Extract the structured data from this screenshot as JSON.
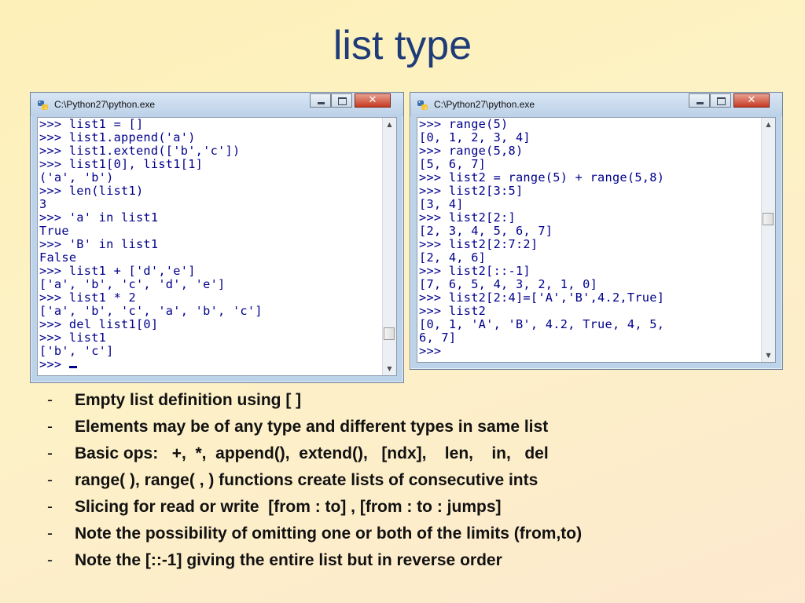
{
  "slide": {
    "title": "list type"
  },
  "windows": [
    {
      "title": "C:\\Python27\\python.exe",
      "icon": "python-icon",
      "controls": {
        "minimize": "minimize-icon",
        "maximize": "maximize-icon",
        "close": "close-icon"
      },
      "lines": [
        ">>> list1 = []",
        ">>> list1.append('a')",
        ">>> list1.extend(['b','c'])",
        ">>> list1[0], list1[1]",
        "('a', 'b')",
        ">>> len(list1)",
        "3",
        ">>> 'a' in list1",
        "True",
        ">>> 'B' in list1",
        "False",
        ">>> list1 + ['d','e']",
        "['a', 'b', 'c', 'd', 'e']",
        ">>> list1 * 2",
        "['a', 'b', 'c', 'a', 'b', 'c']",
        ">>> del list1[0]",
        ">>> list1",
        "['b', 'c']",
        ">>> "
      ],
      "scroll_position": 0.9
    },
    {
      "title": "C:\\Python27\\python.exe",
      "icon": "python-icon",
      "controls": {
        "minimize": "minimize-icon",
        "maximize": "maximize-icon",
        "close": "close-icon"
      },
      "lines": [
        ">>> range(5)",
        "[0, 1, 2, 3, 4]",
        ">>> range(5,8)",
        "[5, 6, 7]",
        ">>> list2 = range(5) + range(5,8)",
        ">>> list2[3:5]",
        "[3, 4]",
        ">>> list2[2:]",
        "[2, 3, 4, 5, 6, 7]",
        ">>> list2[2:7:2]",
        "[2, 4, 6]",
        ">>> list2[::-1]",
        "[7, 6, 5, 4, 3, 2, 1, 0]",
        ">>> list2[2:4]=['A','B',4.2,True]",
        ">>> list2",
        "[0, 1, 'A', 'B', 4.2, True, 4, 5,",
        "6, 7]",
        ">>>"
      ],
      "scroll_position": 0.4
    }
  ],
  "bullets": {
    "dash": "-",
    "items": [
      "Empty list definition using [ ]",
      "Elements may be of any type and different types in same list",
      "Basic ops:   +,  *,  append(),  extend(),   [ndx],    len,    in,   del",
      "range( ), range( , ) functions create lists of consecutive ints",
      "Slicing for read or write  [from : to] , [from : to : jumps]",
      "Note the possibility of omitting one or both of the limits (from,to)",
      "Note the [::-1] giving the entire list but in reverse order"
    ]
  }
}
